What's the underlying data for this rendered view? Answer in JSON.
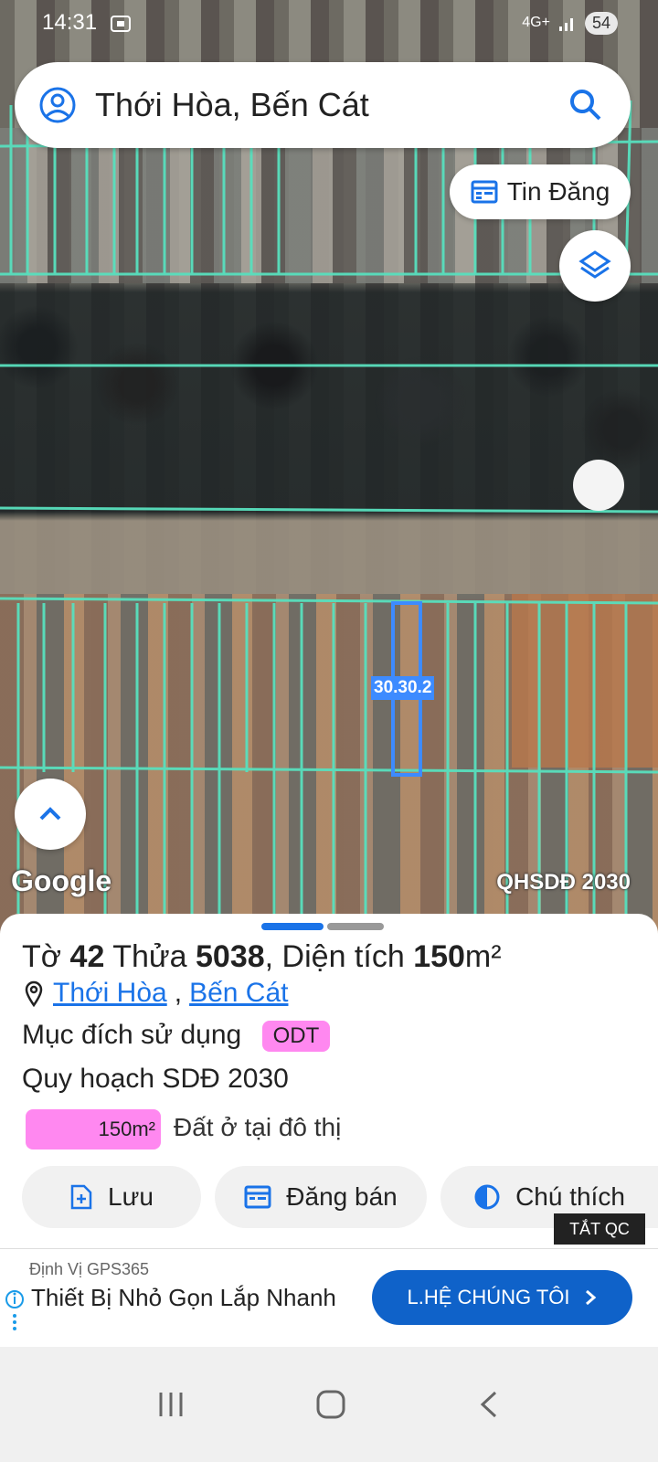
{
  "status_bar": {
    "time": "14:31",
    "network": "4G+",
    "battery": "54"
  },
  "search": {
    "title": "Thới Hòa, Bến Cát"
  },
  "map": {
    "tin_dang_label": "Tin Đăng",
    "google_logo": "Google",
    "plan_label": "QHSDĐ 2030",
    "parcel_label": "30.30.2"
  },
  "sheet": {
    "line1": {
      "to_label": "Tờ",
      "to_value": "42",
      "thua_label": "Thửa",
      "thua_value": "5038",
      "dientich_label": ", Diện tích",
      "area_value": "150",
      "area_unit": "m²"
    },
    "location": {
      "ward": "Thới Hòa",
      "district": "Bến Cát"
    },
    "purpose_label": "Mục đích sử dụng",
    "purpose_code": "ODT",
    "plan_title": "Quy hoạch SDĐ 2030",
    "area_badge": "150m²",
    "area_desc": "Đất ở tại đô thị",
    "actions": {
      "save": "Lưu",
      "post_sale": "Đăng bán",
      "legend": "Chú thích"
    },
    "ads_off": "TẮT QC"
  },
  "ad": {
    "source": "Định Vị GPS365",
    "text": "Thiết Bị Nhỏ Gọn Lắp Nhanh",
    "cta": "L.HỆ CHÚNG TÔI"
  },
  "icons": [
    "avatar-icon",
    "search-icon",
    "calendar-icon",
    "layers-icon",
    "chevron-up-icon",
    "pin-icon",
    "add-file-icon",
    "half-circle-icon",
    "chevron-right-icon",
    "info-icon"
  ]
}
